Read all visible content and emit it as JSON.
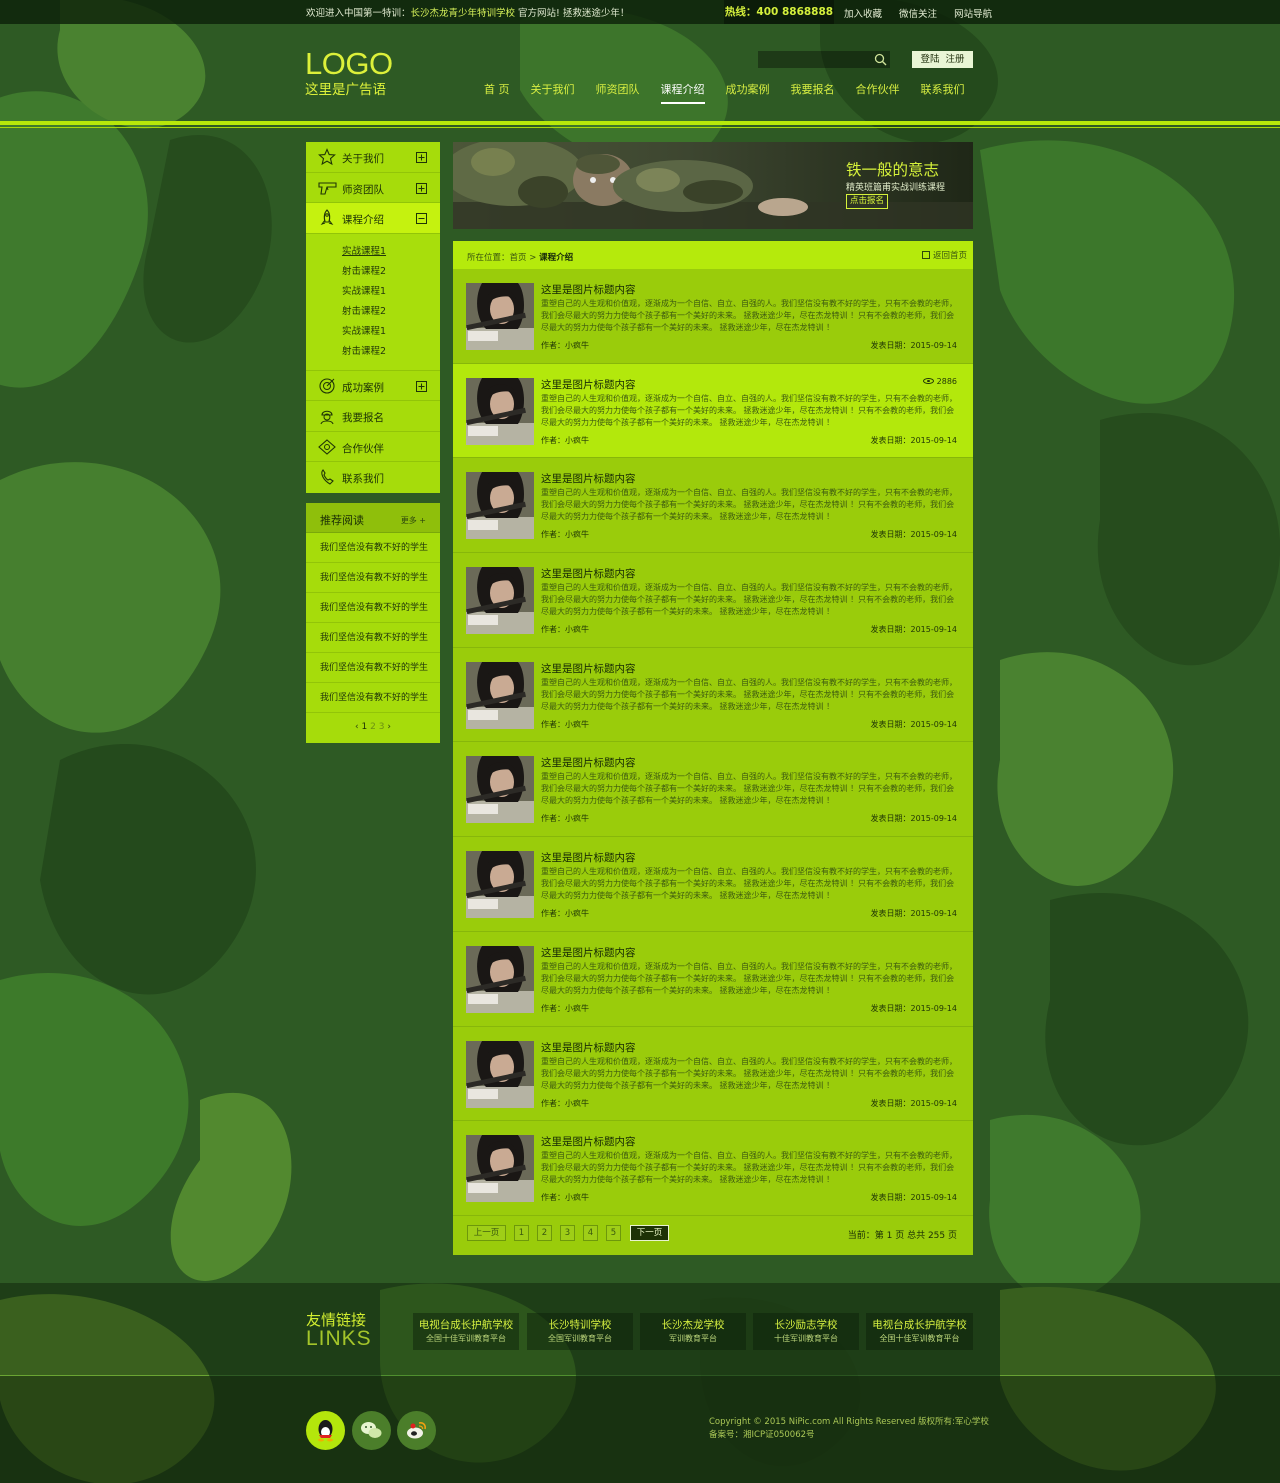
{
  "topbar": {
    "welcome_prefix": "欢迎进入中国第一特训：",
    "welcome_highlight": "长沙杰龙青少年特训学校",
    "welcome_suffix": " 官方网站! 拯救迷途少年！",
    "hotline": "热线：400 8868888",
    "links": [
      "加入收藏",
      "微信关注",
      "网站导航"
    ]
  },
  "header": {
    "logo": "LOGO",
    "slogan": "这里是广告语",
    "search_placeholder": "",
    "login": "登陆",
    "register": "注册",
    "nav": [
      {
        "label": "首 页",
        "active": false
      },
      {
        "label": "关于我们",
        "active": false
      },
      {
        "label": "师资团队",
        "active": false
      },
      {
        "label": "课程介绍",
        "active": true
      },
      {
        "label": "成功案例",
        "active": false
      },
      {
        "label": "我要报名",
        "active": false
      },
      {
        "label": "合作伙伴",
        "active": false
      },
      {
        "label": "联系我们",
        "active": false
      }
    ]
  },
  "sidebar": {
    "menu": [
      {
        "label": "关于我们",
        "icon": "star-icon",
        "toggle": "plus"
      },
      {
        "label": "师资团队",
        "icon": "pistol-icon",
        "toggle": "plus"
      },
      {
        "label": "课程介绍",
        "icon": "rocket-icon",
        "toggle": "minus",
        "active": true
      },
      {
        "label": "成功案例",
        "icon": "target-icon",
        "toggle": "plus"
      },
      {
        "label": "我要报名",
        "icon": "soldier-icon",
        "toggle": ""
      },
      {
        "label": "合作伙伴",
        "icon": "badge-icon",
        "toggle": ""
      },
      {
        "label": "联系我们",
        "icon": "phone-icon",
        "toggle": ""
      }
    ],
    "submenu": [
      "实战课程1",
      "射击课程2",
      "实战课程1",
      "射击课程2",
      "实战课程1",
      "射击课程2"
    ]
  },
  "recommend": {
    "title": "推荐阅读",
    "more": "更多 +",
    "items": [
      "我们坚信没有教不好的学生",
      "我们坚信没有教不好的学生",
      "我们坚信没有教不好的学生",
      "我们坚信没有教不好的学生",
      "我们坚信没有教不好的学生",
      "我们坚信没有教不好的学生"
    ],
    "pages": [
      "1",
      "2",
      "3"
    ]
  },
  "banner": {
    "title": "铁一般的意志",
    "subtitle": "精英班篇甫实战训练课程",
    "button": "点击报名"
  },
  "breadcrumb": {
    "prefix": "所在位置：",
    "home": "首页",
    "current": "课程介绍",
    "back": "返回首页"
  },
  "articles": [
    {
      "title": "这里是图片标题内容",
      "desc": "重塑自己的人生观和价值观，逐渐成为一个自信、自立、自强的人。我们坚信没有教不好的学生，只有不会教的老师，我们会尽最大的努力力使每个孩子都有一个美好的未来。 拯救迷途少年，尽在杰龙特训 ！只有不会教的老师，我们会尽最大的努力力使每个孩子都有一个美好的未来。 拯救迷途少年，尽在杰龙特训 ！",
      "author": "作者：小疯牛",
      "date": "发表日期：2015-09-14",
      "views": ""
    },
    {
      "title": "这里是图片标题内容",
      "desc": "重塑自己的人生观和价值观，逐渐成为一个自信、自立、自强的人。我们坚信没有教不好的学生，只有不会教的老师，我们会尽最大的努力力使每个孩子都有一个美好的未来。 拯救迷途少年，尽在杰龙特训 ！只有不会教的老师，我们会尽最大的努力力使每个孩子都有一个美好的未来。 拯救迷途少年，尽在杰龙特训 ！",
      "author": "作者：小疯牛",
      "date": "发表日期：2015-09-14",
      "views": "2886"
    },
    {
      "title": "这里是图片标题内容",
      "desc": "重塑自己的人生观和价值观，逐渐成为一个自信、自立、自强的人。我们坚信没有教不好的学生，只有不会教的老师，我们会尽最大的努力力使每个孩子都有一个美好的未来。 拯救迷途少年，尽在杰龙特训 ！只有不会教的老师，我们会尽最大的努力力使每个孩子都有一个美好的未来。 拯救迷途少年，尽在杰龙特训 ！",
      "author": "作者：小疯牛",
      "date": "发表日期：2015-09-14",
      "views": ""
    },
    {
      "title": "这里是图片标题内容",
      "desc": "重塑自己的人生观和价值观，逐渐成为一个自信、自立、自强的人。我们坚信没有教不好的学生，只有不会教的老师，我们会尽最大的努力力使每个孩子都有一个美好的未来。 拯救迷途少年，尽在杰龙特训 ！只有不会教的老师，我们会尽最大的努力力使每个孩子都有一个美好的未来。 拯救迷途少年，尽在杰龙特训 ！",
      "author": "作者：小疯牛",
      "date": "发表日期：2015-09-14",
      "views": ""
    },
    {
      "title": "这里是图片标题内容",
      "desc": "重塑自己的人生观和价值观，逐渐成为一个自信、自立、自强的人。我们坚信没有教不好的学生，只有不会教的老师，我们会尽最大的努力力使每个孩子都有一个美好的未来。 拯救迷途少年，尽在杰龙特训 ！只有不会教的老师，我们会尽最大的努力力使每个孩子都有一个美好的未来。 拯救迷途少年，尽在杰龙特训 ！",
      "author": "作者：小疯牛",
      "date": "发表日期：2015-09-14",
      "views": ""
    },
    {
      "title": "这里是图片标题内容",
      "desc": "重塑自己的人生观和价值观，逐渐成为一个自信、自立、自强的人。我们坚信没有教不好的学生，只有不会教的老师，我们会尽最大的努力力使每个孩子都有一个美好的未来。 拯救迷途少年，尽在杰龙特训 ！只有不会教的老师，我们会尽最大的努力力使每个孩子都有一个美好的未来。 拯救迷途少年，尽在杰龙特训 ！",
      "author": "作者：小疯牛",
      "date": "发表日期：2015-09-14",
      "views": ""
    },
    {
      "title": "这里是图片标题内容",
      "desc": "重塑自己的人生观和价值观，逐渐成为一个自信、自立、自强的人。我们坚信没有教不好的学生，只有不会教的老师，我们会尽最大的努力力使每个孩子都有一个美好的未来。 拯救迷途少年，尽在杰龙特训 ！只有不会教的老师，我们会尽最大的努力力使每个孩子都有一个美好的未来。 拯救迷途少年，尽在杰龙特训 ！",
      "author": "作者：小疯牛",
      "date": "发表日期：2015-09-14",
      "views": ""
    },
    {
      "title": "这里是图片标题内容",
      "desc": "重塑自己的人生观和价值观，逐渐成为一个自信、自立、自强的人。我们坚信没有教不好的学生，只有不会教的老师，我们会尽最大的努力力使每个孩子都有一个美好的未来。 拯救迷途少年，尽在杰龙特训 ！只有不会教的老师，我们会尽最大的努力力使每个孩子都有一个美好的未来。 拯救迷途少年，尽在杰龙特训 ！",
      "author": "作者：小疯牛",
      "date": "发表日期：2015-09-14",
      "views": ""
    },
    {
      "title": "这里是图片标题内容",
      "desc": "重塑自己的人生观和价值观，逐渐成为一个自信、自立、自强的人。我们坚信没有教不好的学生，只有不会教的老师，我们会尽最大的努力力使每个孩子都有一个美好的未来。 拯救迷途少年，尽在杰龙特训 ！只有不会教的老师，我们会尽最大的努力力使每个孩子都有一个美好的未来。 拯救迷途少年，尽在杰龙特训 ！",
      "author": "作者：小疯牛",
      "date": "发表日期：2015-09-14",
      "views": ""
    },
    {
      "title": "这里是图片标题内容",
      "desc": "重塑自己的人生观和价值观，逐渐成为一个自信、自立、自强的人。我们坚信没有教不好的学生，只有不会教的老师，我们会尽最大的努力力使每个孩子都有一个美好的未来。 拯救迷途少年，尽在杰龙特训 ！只有不会教的老师，我们会尽最大的努力力使每个孩子都有一个美好的未来。 拯救迷途少年，尽在杰龙特训 ！",
      "author": "作者：小疯牛",
      "date": "发表日期：2015-09-14",
      "views": ""
    }
  ],
  "pager": {
    "prev": "上一页",
    "pages": [
      "1",
      "2",
      "3",
      "4",
      "5"
    ],
    "next": "下一页",
    "status": "当前：第 1 页  总共 255 页"
  },
  "footer": {
    "links_title": "友情链接",
    "links_title_en": "LINKS",
    "links": [
      {
        "name": "电视台成长护航学校",
        "sub": "全国十佳军训教育平台"
      },
      {
        "name": "长沙特训学校",
        "sub": "全国军训教育平台"
      },
      {
        "name": "长沙杰龙学校",
        "sub": "军训教育平台"
      },
      {
        "name": "长沙励志学校",
        "sub": "十佳军训教育平台"
      },
      {
        "name": "电视台成长护航学校",
        "sub": "全国十佳军训教育平台"
      }
    ],
    "copyright": "Copyright © 2015 NiPic.com All Rights Reserved    版权所有:军心学校",
    "icp": "备案号：湘ICP证050062号"
  },
  "colors": {
    "accent": "#b7e80a",
    "panel": "#a6dc0b",
    "content": "#9acc0b",
    "text_light": "#dcf03a"
  }
}
